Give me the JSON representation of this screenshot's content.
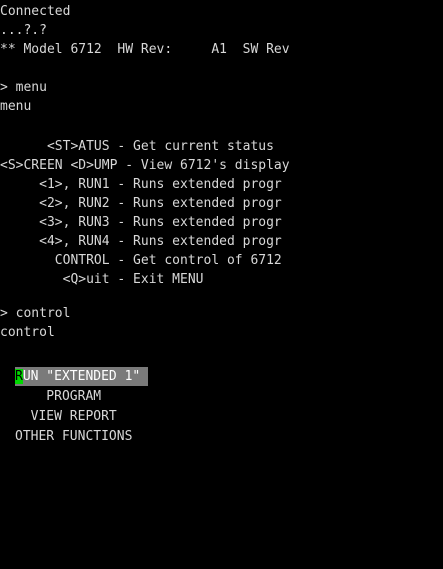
{
  "terminal": {
    "lines": [
      "Connected",
      "...?.?",
      "** Model 6712  HW Rev:     A1  SW Rev",
      "",
      "> menu",
      "menu",
      "",
      "      <ST>ATUS - Get current status",
      "<S>CREEN <D>UMP - View 6712's display",
      "     <1>, RUN1 - Runs extended progr",
      "     <2>, RUN2 - Runs extended progr",
      "     <3>, RUN3 - Runs extended progr",
      "     <4>, RUN4 - Runs extended progr",
      "       CONTROL - Get control of 6712",
      "        <Q>uit - Exit MENU",
      "",
      "> control",
      "control"
    ],
    "control_menu": {
      "selected": {
        "cursor_char": "R",
        "rest": "UN \"EXTENDED 1\" "
      },
      "options": [
        "    PROGRAM",
        "  VIEW REPORT",
        "OTHER FUNCTIONS"
      ]
    }
  },
  "colors": {
    "background": "#000000",
    "text": "#d8d8d8",
    "highlight": "#7a7a7a",
    "cursor": "#00d800"
  }
}
